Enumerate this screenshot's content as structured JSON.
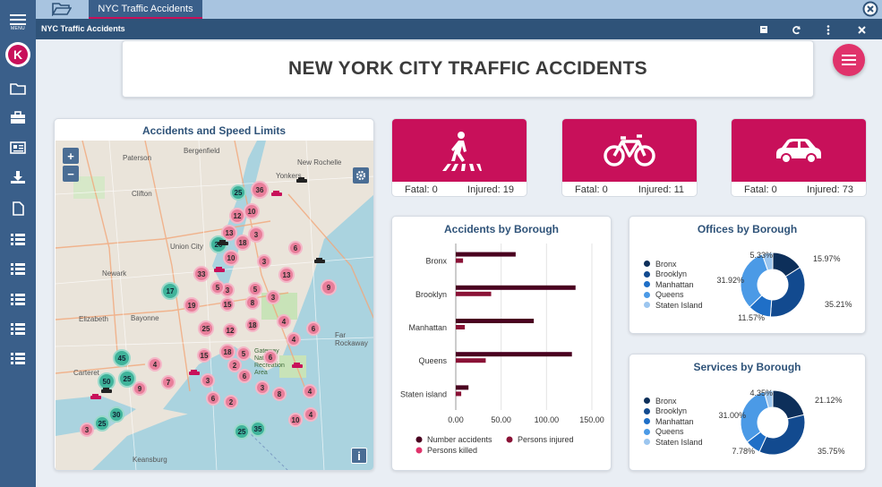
{
  "sidebar": {
    "menu_label": "MENU",
    "logo_letter": "K",
    "items": [
      "folder-icon",
      "briefcase-icon",
      "newspaper-icon",
      "download-icon",
      "document-icon",
      "list-icon",
      "list-icon",
      "list-icon",
      "list-icon",
      "list-icon"
    ]
  },
  "tabbar": {
    "active_tab": "NYC Traffic Accidents"
  },
  "titlebar": {
    "title": "NYC Traffic Accidents"
  },
  "header": {
    "title": "NEW YORK CITY TRAFFIC ACCIDENTS"
  },
  "map": {
    "title": "Accidents and Speed Limits",
    "zoom_in": "+",
    "zoom_out": "−",
    "info": "i",
    "places": [
      "Paterson",
      "Bergenfield",
      "New Rochelle",
      "Yonkers",
      "Clifton",
      "Union City",
      "Newark",
      "Elizabeth",
      "Bayonne",
      "Carteret",
      "Keansburg",
      "Gateway National Recreation Area",
      "Far Rockaway"
    ],
    "clusters": [
      {
        "label": "25",
        "color": "green"
      },
      {
        "label": "36",
        "color": "pink"
      },
      {
        "label": "10",
        "color": "pink"
      },
      {
        "label": "12",
        "color": "pink"
      },
      {
        "label": "13",
        "color": "pink"
      },
      {
        "label": "3",
        "color": "pink"
      },
      {
        "label": "6",
        "color": "pink"
      },
      {
        "label": "20",
        "color": "green"
      },
      {
        "label": "18",
        "color": "pink"
      },
      {
        "label": "3",
        "color": "pink"
      },
      {
        "label": "33",
        "color": "pink"
      },
      {
        "label": "10",
        "color": "pink"
      },
      {
        "label": "13",
        "color": "pink"
      },
      {
        "label": "9",
        "color": "pink"
      },
      {
        "label": "3",
        "color": "pink"
      },
      {
        "label": "5",
        "color": "pink"
      },
      {
        "label": "17",
        "color": "green"
      },
      {
        "label": "19",
        "color": "pink"
      },
      {
        "label": "5",
        "color": "pink"
      },
      {
        "label": "15",
        "color": "pink"
      },
      {
        "label": "8",
        "color": "pink"
      },
      {
        "label": "3",
        "color": "pink"
      },
      {
        "label": "18",
        "color": "pink"
      },
      {
        "label": "4",
        "color": "pink"
      },
      {
        "label": "25",
        "color": "pink"
      },
      {
        "label": "4",
        "color": "pink"
      },
      {
        "label": "6",
        "color": "pink"
      },
      {
        "label": "12",
        "color": "pink"
      },
      {
        "label": "18",
        "color": "pink"
      },
      {
        "label": "5",
        "color": "pink"
      },
      {
        "label": "6",
        "color": "pink"
      },
      {
        "label": "3",
        "color": "pink"
      },
      {
        "label": "45",
        "color": "green"
      },
      {
        "label": "2",
        "color": "pink"
      },
      {
        "label": "4",
        "color": "pink"
      },
      {
        "label": "15",
        "color": "pink"
      },
      {
        "label": "6",
        "color": "pink"
      },
      {
        "label": "50",
        "color": "green"
      },
      {
        "label": "25",
        "color": "green"
      },
      {
        "label": "7",
        "color": "pink"
      },
      {
        "label": "3",
        "color": "pink"
      },
      {
        "label": "9",
        "color": "pink"
      },
      {
        "label": "8",
        "color": "pink"
      },
      {
        "label": "2",
        "color": "pink"
      },
      {
        "label": "6",
        "color": "pink"
      },
      {
        "label": "4",
        "color": "pink"
      },
      {
        "label": "30",
        "color": "green"
      },
      {
        "label": "25",
        "color": "green"
      },
      {
        "label": "3",
        "color": "pink"
      },
      {
        "label": "25",
        "color": "green"
      },
      {
        "label": "35",
        "color": "green"
      },
      {
        "label": "4",
        "color": "pink"
      },
      {
        "label": "10",
        "color": "pink"
      }
    ]
  },
  "kpis": [
    {
      "icon": "pedestrian-icon",
      "fatal": "Fatal: 0",
      "injured": "Injured: 19"
    },
    {
      "icon": "bicycle-icon",
      "fatal": "Fatal: 0",
      "injured": "Injured: 11"
    },
    {
      "icon": "car-icon",
      "fatal": "Fatal: 0",
      "injured": "Injured: 73"
    }
  ],
  "chart_data": [
    {
      "type": "bar",
      "orientation": "horizontal",
      "title": "Accidents by Borough",
      "categories": [
        "Bronx",
        "Brooklyn",
        "Manhattan",
        "Queens",
        "Staten island"
      ],
      "series": [
        {
          "name": "Number accidents",
          "values": [
            66,
            132,
            86,
            128,
            14
          ],
          "color": "#4a0020"
        },
        {
          "name": "Persons injured",
          "values": [
            8,
            39,
            10,
            33,
            6
          ],
          "color": "#8a1236"
        },
        {
          "name": "Persons killed",
          "values": [
            0,
            0,
            0,
            0,
            0
          ],
          "color": "#e0336b"
        }
      ],
      "xlim": [
        0,
        150
      ],
      "xticks": [
        "0.00",
        "50.00",
        "100.00",
        "150.00"
      ],
      "grid": true,
      "legend": "bottom"
    },
    {
      "type": "pie",
      "title": "Offices by Borough",
      "categories": [
        "Bronx",
        "Brooklyn",
        "Manhattan",
        "Queens",
        "Staten Island"
      ],
      "values": [
        15.97,
        35.21,
        11.57,
        31.92,
        5.33
      ],
      "labels": [
        "15.97%",
        "35.21%",
        "11.57%",
        "31.92%",
        "5.33%"
      ],
      "colors": [
        "#0d2f5a",
        "#124a8f",
        "#1f6fc7",
        "#4b9ae6",
        "#9cc6ef"
      ],
      "legend": "left"
    },
    {
      "type": "pie",
      "title": "Services by Borough",
      "categories": [
        "Bronx",
        "Brooklyn",
        "Manhattan",
        "Queens",
        "Staten Island"
      ],
      "values": [
        21.12,
        35.75,
        7.78,
        31.0,
        4.35
      ],
      "labels": [
        "21.12%",
        "35.75%",
        "7.78%",
        "31.00%",
        "4.35%"
      ],
      "colors": [
        "#0d2f5a",
        "#124a8f",
        "#1f6fc7",
        "#4b9ae6",
        "#9cc6ef"
      ],
      "legend": "left"
    }
  ],
  "colors": {
    "accent": "#c8105a",
    "sidebar": "#3a5f8a",
    "title_blue": "#2f5379"
  }
}
